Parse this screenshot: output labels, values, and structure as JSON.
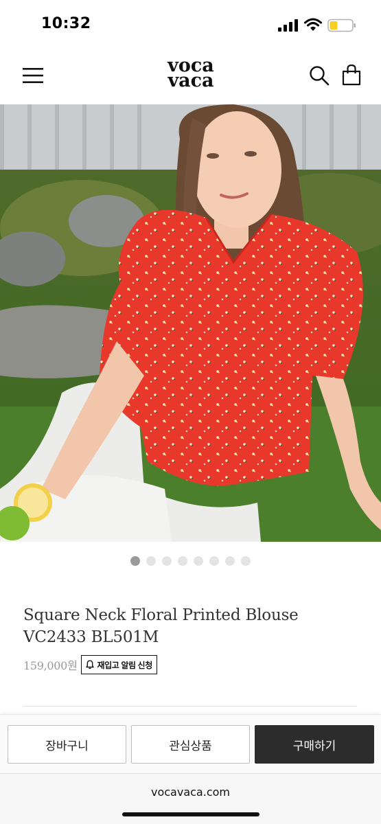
{
  "status_bar": {
    "time": "10:32"
  },
  "header": {
    "logo_line1": "voca",
    "logo_line2": "vaca",
    "icons": [
      "hamburger-menu-icon",
      "search-icon",
      "shopping-bag-icon"
    ]
  },
  "gallery": {
    "image_count": 8,
    "active_index": 0
  },
  "product": {
    "title": "Square Neck Floral Printed Blouse VC2433 BL501M",
    "price": "159,000원",
    "restock_label": "재입고 알림 신청"
  },
  "actions": {
    "cart_label": "장바구니",
    "wishlist_label": "관심상품",
    "buy_label": "구매하기"
  },
  "browser": {
    "url": "vocavaca.com"
  },
  "colors": {
    "buy_button": "#2c2c2c",
    "blouse_red": "#e8382c",
    "active_dot": "#9a9a9a"
  }
}
